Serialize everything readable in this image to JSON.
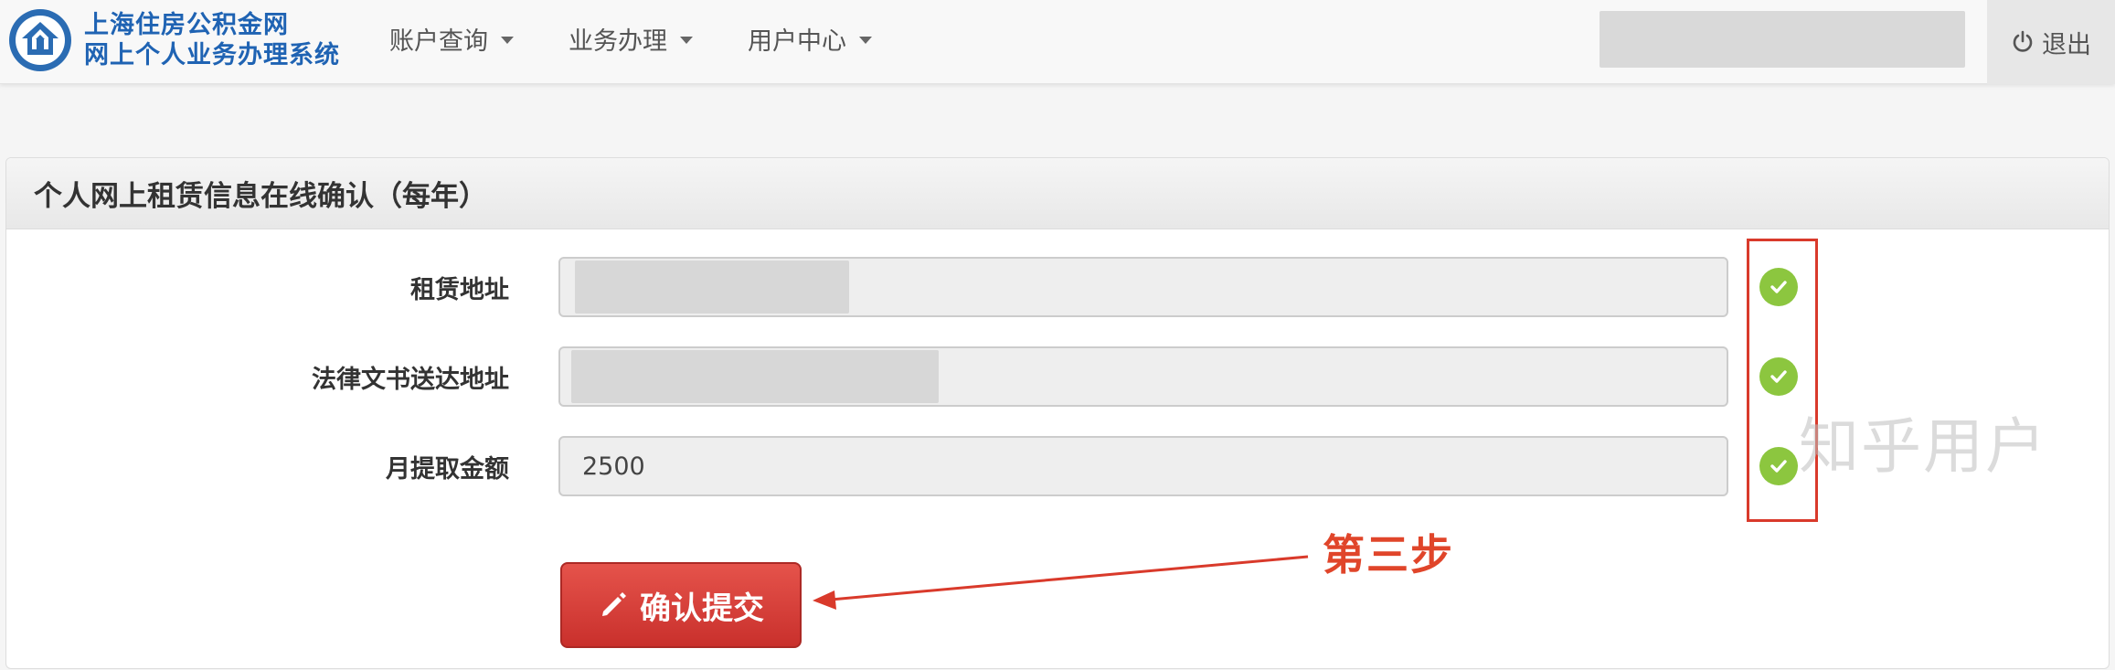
{
  "brand": {
    "line1": "上海住房公积金网",
    "line2": "网上个人业务办理系统",
    "logo_icon": "house-circle-icon",
    "color": "#1f63b3"
  },
  "nav": {
    "items": [
      {
        "label": "账户查询"
      },
      {
        "label": "业务办理"
      },
      {
        "label": "用户中心"
      }
    ],
    "logout_label": "退出"
  },
  "panel": {
    "title": "个人网上租赁信息在线确认（每年）"
  },
  "form": {
    "fields": [
      {
        "label": "租赁地址",
        "value": "",
        "status": "valid"
      },
      {
        "label": "法律文书送达地址",
        "value": "",
        "status": "valid"
      },
      {
        "label": "月提取金额",
        "value": "2500",
        "status": "valid"
      }
    ],
    "submit_label": "确认提交"
  },
  "annotation": {
    "step_label": "第三步",
    "color": "#d93a2b"
  },
  "watermark": "知乎用户",
  "colors": {
    "check": "#8cc63f",
    "submit": "#d9534f"
  }
}
